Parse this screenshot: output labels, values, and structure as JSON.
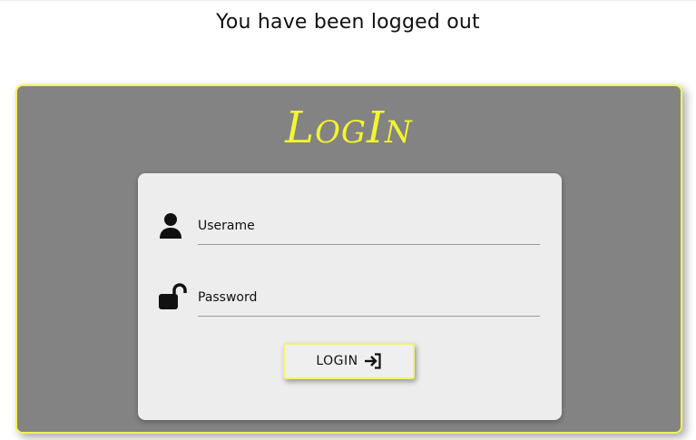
{
  "message": "You have been logged out",
  "login": {
    "title": "LogIn",
    "username": {
      "label": "Userame",
      "icon": "user-icon"
    },
    "password": {
      "label": "Password",
      "icon": "unlock-icon"
    },
    "button": {
      "label": "LOGIN",
      "icon": "sign-in-icon"
    }
  },
  "colors": {
    "panel_bg": "#838383",
    "accent": "#f4f430",
    "card_bg": "#ededed"
  }
}
